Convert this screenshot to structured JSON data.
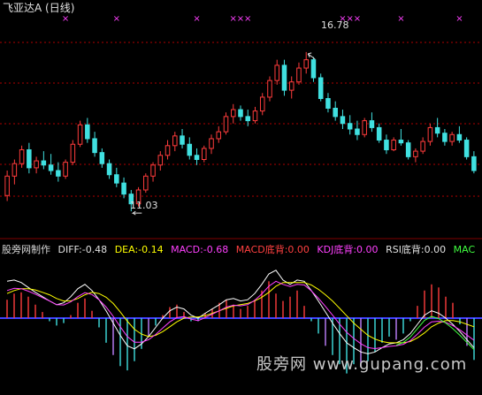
{
  "watermark": "股旁网 www.gupang.com",
  "colors": {
    "up": "#ff3c3c",
    "down": "#40e0e0",
    "grid": "#b00000",
    "marker": "#ff40ff",
    "diff_line": "#ffffff",
    "dea_line": "#ffff00",
    "macd_line": "#ff40ff",
    "mac_line": "#40ff40",
    "zero_line": "#4040ff"
  },
  "chart_data": [
    {
      "type": "candlestick",
      "title": "飞亚达A (日线)",
      "high_label": "16.78",
      "low_label": "11.03",
      "y_range": [
        10.3,
        17.7
      ],
      "grid": true,
      "markers_top": [
        8,
        15,
        26,
        31,
        32,
        33,
        46,
        47,
        48,
        54,
        62,
        70,
        71,
        72,
        78
      ],
      "bars": [
        [
          11.6,
          12.5,
          11.4,
          12.3
        ],
        [
          12.3,
          12.9,
          12.0,
          12.75
        ],
        [
          12.75,
          13.4,
          12.6,
          13.25
        ],
        [
          13.25,
          13.5,
          12.4,
          12.6
        ],
        [
          12.6,
          13.0,
          12.4,
          12.85
        ],
        [
          12.85,
          13.2,
          12.55,
          12.7
        ],
        [
          12.7,
          13.1,
          12.35,
          12.5
        ],
        [
          12.5,
          12.8,
          12.1,
          12.3
        ],
        [
          12.3,
          12.9,
          12.2,
          12.8
        ],
        [
          12.8,
          13.6,
          12.7,
          13.45
        ],
        [
          13.45,
          14.3,
          13.35,
          14.15
        ],
        [
          14.15,
          14.4,
          13.5,
          13.65
        ],
        [
          13.65,
          13.9,
          13.0,
          13.15
        ],
        [
          13.15,
          13.3,
          12.6,
          12.75
        ],
        [
          12.75,
          12.9,
          12.2,
          12.35
        ],
        [
          12.35,
          12.6,
          11.9,
          12.05
        ],
        [
          12.05,
          12.25,
          11.5,
          11.65
        ],
        [
          11.65,
          11.8,
          11.03,
          11.3
        ],
        [
          11.3,
          11.9,
          11.2,
          11.8
        ],
        [
          11.8,
          12.4,
          11.7,
          12.3
        ],
        [
          12.3,
          12.8,
          12.1,
          12.7
        ],
        [
          12.7,
          13.2,
          12.5,
          13.05
        ],
        [
          13.05,
          13.6,
          12.9,
          13.4
        ],
        [
          13.4,
          13.9,
          13.2,
          13.75
        ],
        [
          13.75,
          14.0,
          13.3,
          13.45
        ],
        [
          13.45,
          13.7,
          12.9,
          13.05
        ],
        [
          13.05,
          13.3,
          12.7,
          12.9
        ],
        [
          12.9,
          13.4,
          12.8,
          13.3
        ],
        [
          13.3,
          13.8,
          13.1,
          13.65
        ],
        [
          13.65,
          14.1,
          13.5,
          13.9
        ],
        [
          13.9,
          14.6,
          13.8,
          14.45
        ],
        [
          14.45,
          14.9,
          14.2,
          14.7
        ],
        [
          14.7,
          14.85,
          14.3,
          14.45
        ],
        [
          14.45,
          14.7,
          14.1,
          14.3
        ],
        [
          14.3,
          14.8,
          14.2,
          14.65
        ],
        [
          14.65,
          15.3,
          14.5,
          15.15
        ],
        [
          15.15,
          15.9,
          15.0,
          15.75
        ],
        [
          15.75,
          16.5,
          15.6,
          16.3
        ],
        [
          16.3,
          16.5,
          15.2,
          15.4
        ],
        [
          15.4,
          15.9,
          15.1,
          15.7
        ],
        [
          15.7,
          16.4,
          15.6,
          16.2
        ],
        [
          16.2,
          16.78,
          16.0,
          16.5
        ],
        [
          16.5,
          16.6,
          15.7,
          15.85
        ],
        [
          15.85,
          16.0,
          15.0,
          15.1
        ],
        [
          15.1,
          15.3,
          14.6,
          14.75
        ],
        [
          14.75,
          15.0,
          14.3,
          14.45
        ],
        [
          14.45,
          14.7,
          14.0,
          14.2
        ],
        [
          14.2,
          14.5,
          13.8,
          14.0
        ],
        [
          14.0,
          14.3,
          13.6,
          13.8
        ],
        [
          13.8,
          14.4,
          13.7,
          14.3
        ],
        [
          14.3,
          14.6,
          13.9,
          14.05
        ],
        [
          14.05,
          14.2,
          13.5,
          13.6
        ],
        [
          13.6,
          13.8,
          13.1,
          13.25
        ],
        [
          13.25,
          13.7,
          13.2,
          13.6
        ],
        [
          13.6,
          14.0,
          13.4,
          13.5
        ],
        [
          13.5,
          13.6,
          12.9,
          13.0
        ],
        [
          13.0,
          13.3,
          12.8,
          13.2
        ],
        [
          13.2,
          13.7,
          13.1,
          13.55
        ],
        [
          13.55,
          14.2,
          13.4,
          14.05
        ],
        [
          14.05,
          14.4,
          13.7,
          13.85
        ],
        [
          13.85,
          14.0,
          13.4,
          13.55
        ],
        [
          13.55,
          13.9,
          13.4,
          13.8
        ],
        [
          13.8,
          14.1,
          13.5,
          13.6
        ],
        [
          13.6,
          13.7,
          12.9,
          13.0
        ],
        [
          13.0,
          13.2,
          12.4,
          12.5
        ]
      ]
    },
    {
      "type": "bar",
      "title": "股旁网制作",
      "readouts": {
        "diff": "DIFF:-0.48",
        "dea": "DEA:-0.14",
        "macd": "MACD:-0.68",
        "macd_div": "MACD底背:0.00",
        "kdj_div": "KDJ底背:0.00",
        "rsi_div": "RSI底背:0.00",
        "mac": "MAC"
      },
      "y_range": [
        -1.15,
        0.95
      ],
      "histogram": [
        0.3,
        0.4,
        0.42,
        0.35,
        0.22,
        0.1,
        -0.05,
        -0.12,
        -0.08,
        0.05,
        0.25,
        0.32,
        0.12,
        -0.15,
        -0.4,
        -0.6,
        -0.78,
        -0.85,
        -0.7,
        -0.5,
        -0.3,
        -0.12,
        0.05,
        0.18,
        0.22,
        0.1,
        -0.05,
        -0.05,
        0.08,
        0.15,
        0.25,
        0.3,
        0.22,
        0.15,
        0.2,
        0.3,
        0.45,
        0.6,
        0.4,
        0.28,
        0.35,
        0.45,
        0.2,
        -0.05,
        -0.25,
        -0.45,
        -0.6,
        -0.75,
        -0.9,
        -0.75,
        -0.8,
        -0.7,
        -0.55,
        -0.4,
        -0.3,
        -0.35,
        -0.25,
        -0.05,
        0.2,
        0.45,
        0.55,
        0.5,
        0.35,
        0.25,
        -0.1,
        -0.45,
        -0.68
      ],
      "series": [
        {
          "values": [
            0.6,
            0.62,
            0.58,
            0.5,
            0.42,
            0.35,
            0.28,
            0.22,
            0.25,
            0.35,
            0.48,
            0.55,
            0.45,
            0.3,
            0.12,
            -0.08,
            -0.28,
            -0.45,
            -0.5,
            -0.42,
            -0.3,
            -0.15,
            0.0,
            0.12,
            0.18,
            0.15,
            0.05,
            0.0,
            0.08,
            0.15,
            0.22,
            0.3,
            0.32,
            0.28,
            0.3,
            0.4,
            0.55,
            0.72,
            0.78,
            0.62,
            0.55,
            0.62,
            0.6,
            0.45,
            0.28,
            0.1,
            -0.08,
            -0.25,
            -0.4,
            -0.48,
            -0.55,
            -0.58,
            -0.55,
            -0.48,
            -0.42,
            -0.4,
            -0.35,
            -0.25,
            -0.1,
            0.05,
            0.12,
            0.08,
            0.0,
            -0.1,
            -0.22,
            -0.35,
            -0.48
          ]
        },
        {
          "values": [
            0.4,
            0.45,
            0.48,
            0.48,
            0.46,
            0.42,
            0.38,
            0.32,
            0.28,
            0.28,
            0.32,
            0.38,
            0.42,
            0.4,
            0.34,
            0.24,
            0.1,
            -0.05,
            -0.18,
            -0.26,
            -0.3,
            -0.28,
            -0.22,
            -0.14,
            -0.06,
            0.0,
            0.02,
            0.02,
            0.04,
            0.08,
            0.12,
            0.16,
            0.2,
            0.22,
            0.24,
            0.28,
            0.34,
            0.42,
            0.52,
            0.58,
            0.58,
            0.58,
            0.58,
            0.54,
            0.47,
            0.38,
            0.28,
            0.16,
            0.04,
            -0.08,
            -0.18,
            -0.28,
            -0.34,
            -0.38,
            -0.4,
            -0.4,
            -0.4,
            -0.38,
            -0.32,
            -0.24,
            -0.14,
            -0.08,
            -0.04,
            -0.04,
            -0.06,
            -0.1,
            -0.14
          ]
        }
      ]
    }
  ]
}
